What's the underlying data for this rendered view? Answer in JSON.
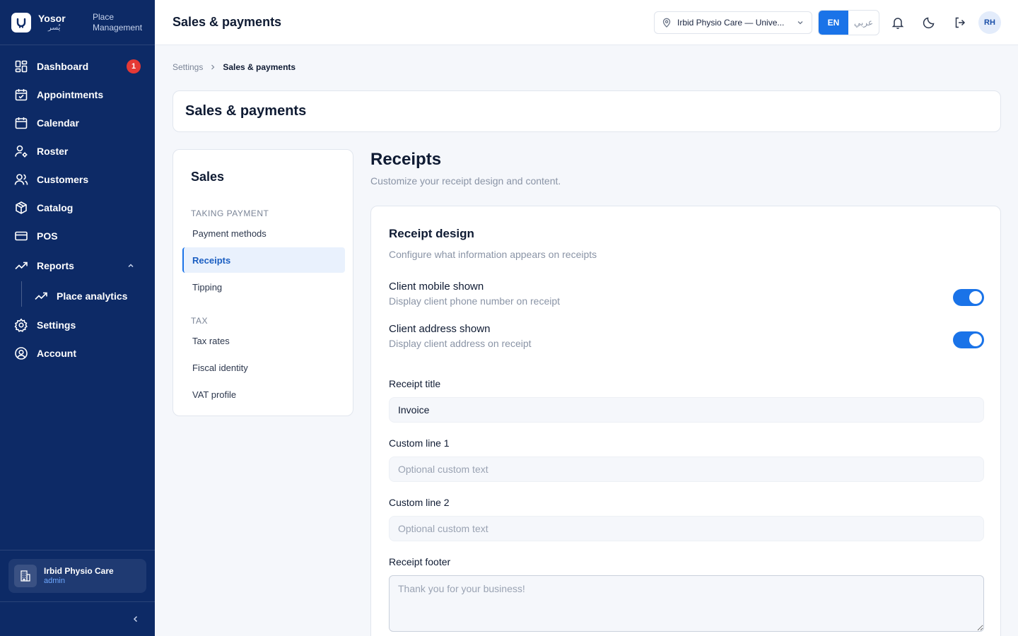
{
  "brand": {
    "name": "Yosor",
    "name_ar": "يُسر",
    "subtitle": "Place Management"
  },
  "sidebar": {
    "items": [
      {
        "label": "Dashboard",
        "badge": "1",
        "icon": "dashboard-icon"
      },
      {
        "label": "Appointments",
        "icon": "calendar-check-icon"
      },
      {
        "label": "Calendar",
        "icon": "calendar-icon"
      },
      {
        "label": "Roster",
        "icon": "user-gear-icon"
      },
      {
        "label": "Customers",
        "icon": "users-icon"
      },
      {
        "label": "Catalog",
        "icon": "box-icon"
      },
      {
        "label": "POS",
        "icon": "card-icon"
      },
      {
        "label": "Reports",
        "icon": "trend-icon",
        "expanded": true
      },
      {
        "label": "Place analytics",
        "icon": "trend-icon"
      },
      {
        "label": "Settings",
        "icon": "gear-icon"
      },
      {
        "label": "Account",
        "icon": "account-icon"
      }
    ],
    "place": {
      "name": "Irbid Physio Care",
      "role": "admin"
    }
  },
  "header": {
    "title": "Sales & payments",
    "location": "Irbid Physio Care — Unive...",
    "lang_en": "EN",
    "lang_ar": "عربي",
    "avatar": "RH"
  },
  "breadcrumb": {
    "parent": "Settings",
    "current": "Sales & payments"
  },
  "page_title": "Sales & payments",
  "menu": {
    "title": "Sales",
    "sections": [
      {
        "heading": "TAKING PAYMENT",
        "items": [
          "Payment methods",
          "Receipts",
          "Tipping"
        ]
      },
      {
        "heading": "TAX",
        "items": [
          "Tax rates",
          "Fiscal identity",
          "VAT profile"
        ]
      }
    ],
    "active": "Receipts"
  },
  "section": {
    "title": "Receipts",
    "subtitle": "Customize your receipt design and content."
  },
  "receipt_design": {
    "title": "Receipt design",
    "subtitle": "Configure what information appears on receipts",
    "toggles": [
      {
        "label": "Client mobile shown",
        "desc": "Display client phone number on receipt",
        "on": true
      },
      {
        "label": "Client address shown",
        "desc": "Display client address on receipt",
        "on": true
      }
    ],
    "fields": {
      "title_label": "Receipt title",
      "title_value": "Invoice",
      "line1_label": "Custom line 1",
      "line1_placeholder": "Optional custom text",
      "line2_label": "Custom line 2",
      "line2_placeholder": "Optional custom text",
      "footer_label": "Receipt footer",
      "footer_placeholder": "Thank you for your business!"
    }
  },
  "colors": {
    "sidebar": "#0d2a66",
    "accent": "#1a73e8",
    "badge": "#e53935"
  }
}
